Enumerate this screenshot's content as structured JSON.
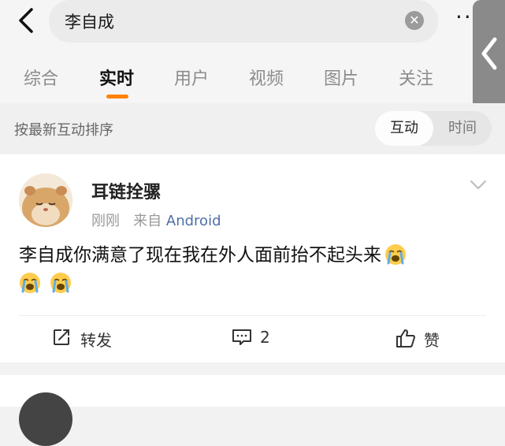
{
  "search": {
    "query": "李自成"
  },
  "tabs": [
    {
      "label": "综合"
    },
    {
      "label": "实时"
    },
    {
      "label": "用户"
    },
    {
      "label": "视频"
    },
    {
      "label": "图片"
    },
    {
      "label": "关注"
    }
  ],
  "sort": {
    "label": "按最新互动排序",
    "options": [
      "互动",
      "时间"
    ],
    "selected": "互动"
  },
  "post": {
    "username": "耳链拴骡",
    "time": "刚刚",
    "source_prefix": "来自",
    "source": "Android",
    "text": "李自成你满意了现在我在外人面前抬不起头来",
    "emoji": [
      "crying-face-icon",
      "crying-face-icon",
      "crying-face-icon"
    ],
    "actions": {
      "repost": "转发",
      "comment_count": "2",
      "like": "赞"
    }
  },
  "colors": {
    "accent": "#ff8200",
    "source_link": "#4f6ea8"
  }
}
